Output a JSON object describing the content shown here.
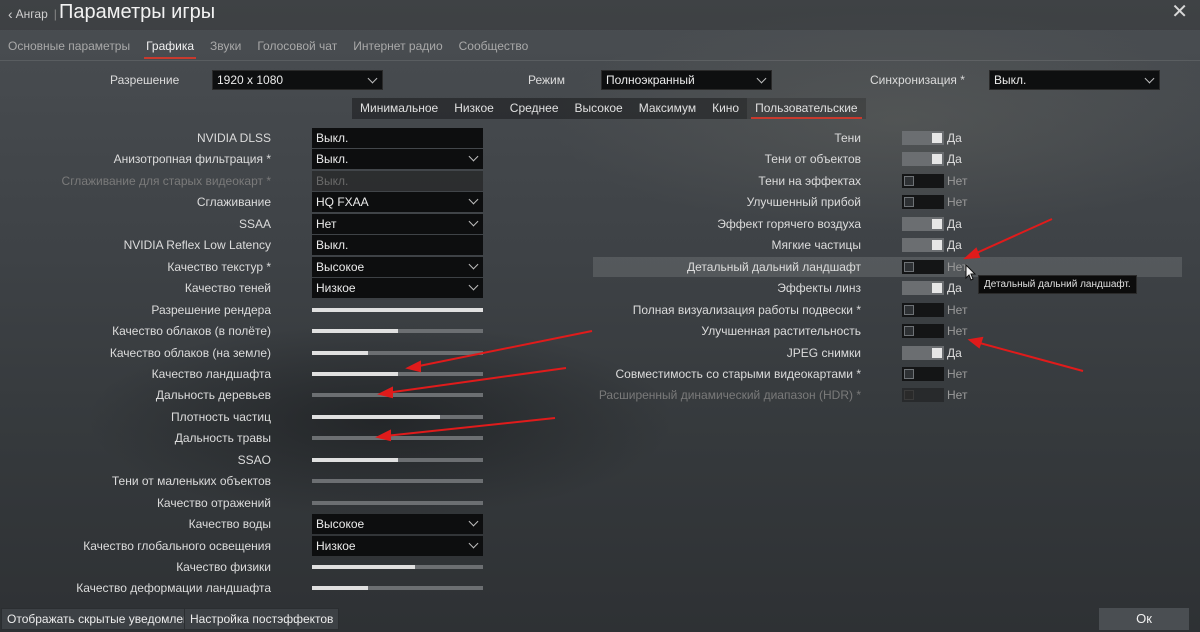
{
  "header": {
    "back_label": "Ангар",
    "back_sep": "|",
    "title": "Параметры игры"
  },
  "tabs": [
    {
      "label": "Основные параметры",
      "active": false
    },
    {
      "label": "Графика",
      "active": true
    },
    {
      "label": "Звуки",
      "active": false
    },
    {
      "label": "Голосовой чат",
      "active": false
    },
    {
      "label": "Интернет радио",
      "active": false
    },
    {
      "label": "Сообщество",
      "active": false
    }
  ],
  "top_settings": {
    "resolution": {
      "label": "Разрешение",
      "value": "1920 x 1080"
    },
    "mode": {
      "label": "Режим",
      "value": "Полноэкранный"
    },
    "sync": {
      "label": "Синхронизация *",
      "value": "Выкл."
    }
  },
  "presets": [
    {
      "label": "Минимальное",
      "active": false
    },
    {
      "label": "Низкое",
      "active": false
    },
    {
      "label": "Среднее",
      "active": false
    },
    {
      "label": "Высокое",
      "active": false
    },
    {
      "label": "Максимум",
      "active": false
    },
    {
      "label": "Кино",
      "active": false
    },
    {
      "label": "Пользовательские",
      "active": true
    }
  ],
  "left_settings": [
    {
      "label": "NVIDIA DLSS",
      "kind": "field",
      "value": "Выкл.",
      "dropdown": false
    },
    {
      "label": "Анизотропная фильтрация *",
      "kind": "field",
      "value": "Выкл.",
      "dropdown": true
    },
    {
      "label": "Сглаживание для старых видеокарт *",
      "kind": "field",
      "value": "Выкл.",
      "dropdown": false,
      "disabled": true
    },
    {
      "label": "Сглаживание",
      "kind": "field",
      "value": "HQ FXAA",
      "dropdown": true
    },
    {
      "label": "SSAA",
      "kind": "field",
      "value": "Нет",
      "dropdown": true
    },
    {
      "label": "NVIDIA Reflex Low Latency",
      "kind": "field",
      "value": "Выкл.",
      "dropdown": false
    },
    {
      "label": "Качество текстур *",
      "kind": "field",
      "value": "Высокое",
      "dropdown": true
    },
    {
      "label": "Качество теней",
      "kind": "field",
      "value": "Низкое",
      "dropdown": true
    },
    {
      "label": "Разрешение рендера",
      "kind": "slider",
      "level": 1.0
    },
    {
      "label": "Качество облаков (в полёте)",
      "kind": "slider",
      "level": 0.5
    },
    {
      "label": "Качество облаков (на земле)",
      "kind": "slider",
      "level": 0.33
    },
    {
      "label": "Качество ландшафта",
      "kind": "slider",
      "level": 0.5
    },
    {
      "label": "Дальность деревьев",
      "kind": "slider",
      "level": 0.0
    },
    {
      "label": "Плотность частиц",
      "kind": "slider",
      "level": 0.75
    },
    {
      "label": "Дальность травы",
      "kind": "slider",
      "level": 0.0
    },
    {
      "label": "SSAO",
      "kind": "slider",
      "level": 0.5
    },
    {
      "label": "Тени от маленьких объектов",
      "kind": "slider",
      "level": 0.0
    },
    {
      "label": "Качество отражений",
      "kind": "slider",
      "level": 0.0
    },
    {
      "label": "Качество воды",
      "kind": "field",
      "value": "Высокое",
      "dropdown": true
    },
    {
      "label": "Качество глобального освещения",
      "kind": "field",
      "value": "Низкое",
      "dropdown": true
    },
    {
      "label": "Качество физики",
      "kind": "slider",
      "level": 0.6
    },
    {
      "label": "Качество деформации ландшафта",
      "kind": "slider",
      "level": 0.33
    }
  ],
  "right_settings": [
    {
      "label": "Тени",
      "on": true,
      "value": "Да"
    },
    {
      "label": "Тени от объектов",
      "on": true,
      "value": "Да"
    },
    {
      "label": "Тени на эффектах",
      "on": false,
      "value": "Нет"
    },
    {
      "label": "Улучшенный прибой",
      "on": false,
      "value": "Нет"
    },
    {
      "label": "Эффект горячего воздуха",
      "on": true,
      "value": "Да"
    },
    {
      "label": "Мягкие частицы",
      "on": true,
      "value": "Да"
    },
    {
      "label": "Детальный дальний ландшафт",
      "on": false,
      "value": "Нет",
      "hover": true
    },
    {
      "label": "Эффекты линз",
      "on": true,
      "value": "Да"
    },
    {
      "label": "Полная визуализация работы подвески *",
      "on": false,
      "value": "Нет"
    },
    {
      "label": "Улучшенная растительность",
      "on": false,
      "value": "Нет"
    },
    {
      "label": "JPEG снимки",
      "on": true,
      "value": "Да"
    },
    {
      "label": "Совместимость со старыми видеокартами *",
      "on": false,
      "value": "Нет"
    },
    {
      "label": "Расширенный динамический диапазон (HDR) *",
      "on": false,
      "value": "Нет",
      "disabled": true
    }
  ],
  "tooltip": "Детальный дальний ландшафт.",
  "footer": {
    "show_hidden": "Отображать скрытые уведомления",
    "postfx": "Настройка постэффектов",
    "ok": "Ок"
  },
  "colors": {
    "accent": "#c83a2e",
    "annotation_arrow": "#e01b1b"
  }
}
